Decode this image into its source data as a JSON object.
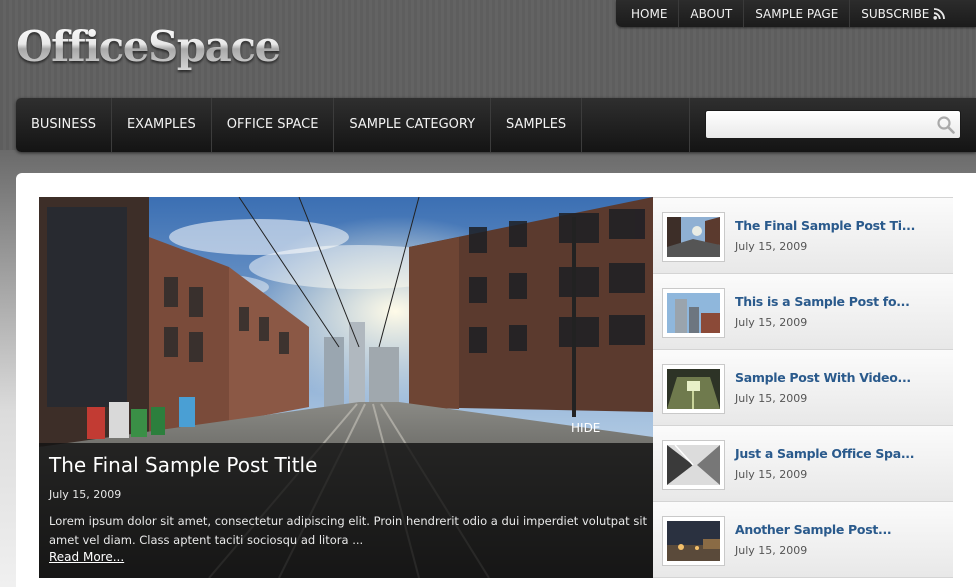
{
  "site": {
    "logo_text": "OfficeSpace"
  },
  "top_nav": [
    "HOME",
    "ABOUT",
    "SAMPLE PAGE",
    "SUBSCRIBE"
  ],
  "main_nav": [
    "BUSINESS",
    "EXAMPLES",
    "OFFICE SPACE",
    "SAMPLE CATEGORY",
    "SAMPLES"
  ],
  "search": {
    "value": "",
    "placeholder": ""
  },
  "featured": {
    "hide_label": "HIDE",
    "title": "The Final Sample Post Title",
    "date": "July 15, 2009",
    "excerpt": "Lorem ipsum dolor sit amet, consectetur adipiscing elit. Proin hendrerit odio a dui imperdiet volutpat sit amet vel diam. Class aptent taciti sociosqu ad litora ...",
    "read_more": "Read More..."
  },
  "posts": [
    {
      "title": "The Final Sample Post Ti...",
      "date": "July 15, 2009"
    },
    {
      "title": "This is a Sample Post fo...",
      "date": "July 15, 2009"
    },
    {
      "title": "Sample Post With Video...",
      "date": "July 15, 2009"
    },
    {
      "title": "Just a Sample Office Spa...",
      "date": "July 15, 2009"
    },
    {
      "title": "Another Sample Post...",
      "date": "July 15, 2009"
    }
  ],
  "colors": {
    "link_blue": "#2a5a8c",
    "nav_dark": "#1b1b1b"
  },
  "icons": {
    "search": "magnifier-icon",
    "subscribe": "rss-icon"
  }
}
